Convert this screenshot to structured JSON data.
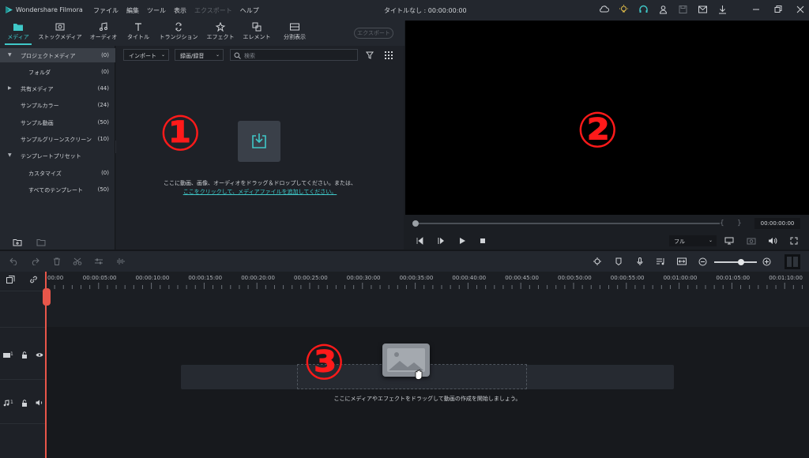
{
  "titlebar": {
    "app_name": "Wondershare Filmora",
    "menu": [
      {
        "label": "ファイル",
        "enabled": true
      },
      {
        "label": "編集",
        "enabled": true
      },
      {
        "label": "ツール",
        "enabled": true
      },
      {
        "label": "表示",
        "enabled": true
      },
      {
        "label": "エクスポート",
        "enabled": false
      },
      {
        "label": "ヘルプ",
        "enabled": true
      }
    ],
    "doc_title": "タイトルなし : 00:00:00:00",
    "icons": [
      "cloud-icon",
      "bulb-icon",
      "headset-icon",
      "account-icon",
      "save-icon",
      "mail-icon",
      "download-icon"
    ],
    "window_icons": [
      "minimize-icon",
      "restore-icon",
      "close-icon"
    ]
  },
  "media_toolbar": {
    "tabs": [
      {
        "label": "メディア",
        "icon": "folder-icon",
        "active": true
      },
      {
        "label": "ストックメディア",
        "icon": "stock-icon",
        "active": false
      },
      {
        "label": "オーディオ",
        "icon": "music-icon",
        "active": false
      },
      {
        "label": "タイトル",
        "icon": "title-icon",
        "active": false
      },
      {
        "label": "トランジション",
        "icon": "transition-icon",
        "active": false
      },
      {
        "label": "エフェクト",
        "icon": "effect-icon",
        "active": false
      },
      {
        "label": "エレメント",
        "icon": "element-icon",
        "active": false
      },
      {
        "label": "分割表示",
        "icon": "split-icon",
        "active": false
      }
    ],
    "export_label": "エクスポート"
  },
  "sidebar": {
    "items": [
      {
        "label": "プロジェクトメディア",
        "count": "(0)",
        "level": 0,
        "arrow": "▼",
        "selected": true
      },
      {
        "label": "フォルダ",
        "count": "(0)",
        "level": 1,
        "arrow": "",
        "selected": false
      },
      {
        "label": "共有メディア",
        "count": "(44)",
        "level": 0,
        "arrow": "▶",
        "selected": false
      },
      {
        "label": "サンプルカラー",
        "count": "(24)",
        "level": 0,
        "arrow": "",
        "selected": false
      },
      {
        "label": "サンプル動画",
        "count": "(50)",
        "level": 0,
        "arrow": "",
        "selected": false
      },
      {
        "label": "サンプルグリーンスクリーン",
        "count": "(10)",
        "level": 0,
        "arrow": "",
        "selected": false
      },
      {
        "label": "テンプレートプリセット",
        "count": "",
        "level": 0,
        "arrow": "▼",
        "selected": false
      },
      {
        "label": "カスタマイズ",
        "count": "(0)",
        "level": 1,
        "arrow": "",
        "selected": false
      },
      {
        "label": "すべてのテンプレート",
        "count": "(50)",
        "level": 1,
        "arrow": "",
        "selected": false
      }
    ]
  },
  "media": {
    "import_label": "インポート",
    "record_label": "録画/録音",
    "search_placeholder": "検索",
    "drop_message": "ここに動画、画像、オーディオをドラッグ＆ドロップしてください。または、",
    "drop_link": "ここをクリックして、メディアファイルを追加してください。"
  },
  "preview": {
    "time": "00:00:00:00",
    "quality": "フル",
    "bracket_in": "{",
    "bracket_out": "}"
  },
  "timeline": {
    "ruler_labels": [
      "00:00",
      "00:00:05:00",
      "00:00:10:00",
      "00:00:15:00",
      "00:00:20:00",
      "00:00:25:00",
      "00:00:30:00",
      "00:00:35:00",
      "00:00:40:00",
      "00:00:45:00",
      "00:00:50:00",
      "00:00:55:00",
      "00:01:00:00",
      "00:01:05:00",
      "00:01:10:00"
    ],
    "video_track_num": "1",
    "audio_track_num": "1",
    "hint": "ここにメディアやエフェクトをドラッグして動画の作成を開始しましょう。"
  },
  "annotations": [
    "①",
    "②",
    "③"
  ],
  "colors": {
    "accent": "#3fc8c8",
    "annotation": "#ff1a1a",
    "playhead": "#e8564a"
  }
}
